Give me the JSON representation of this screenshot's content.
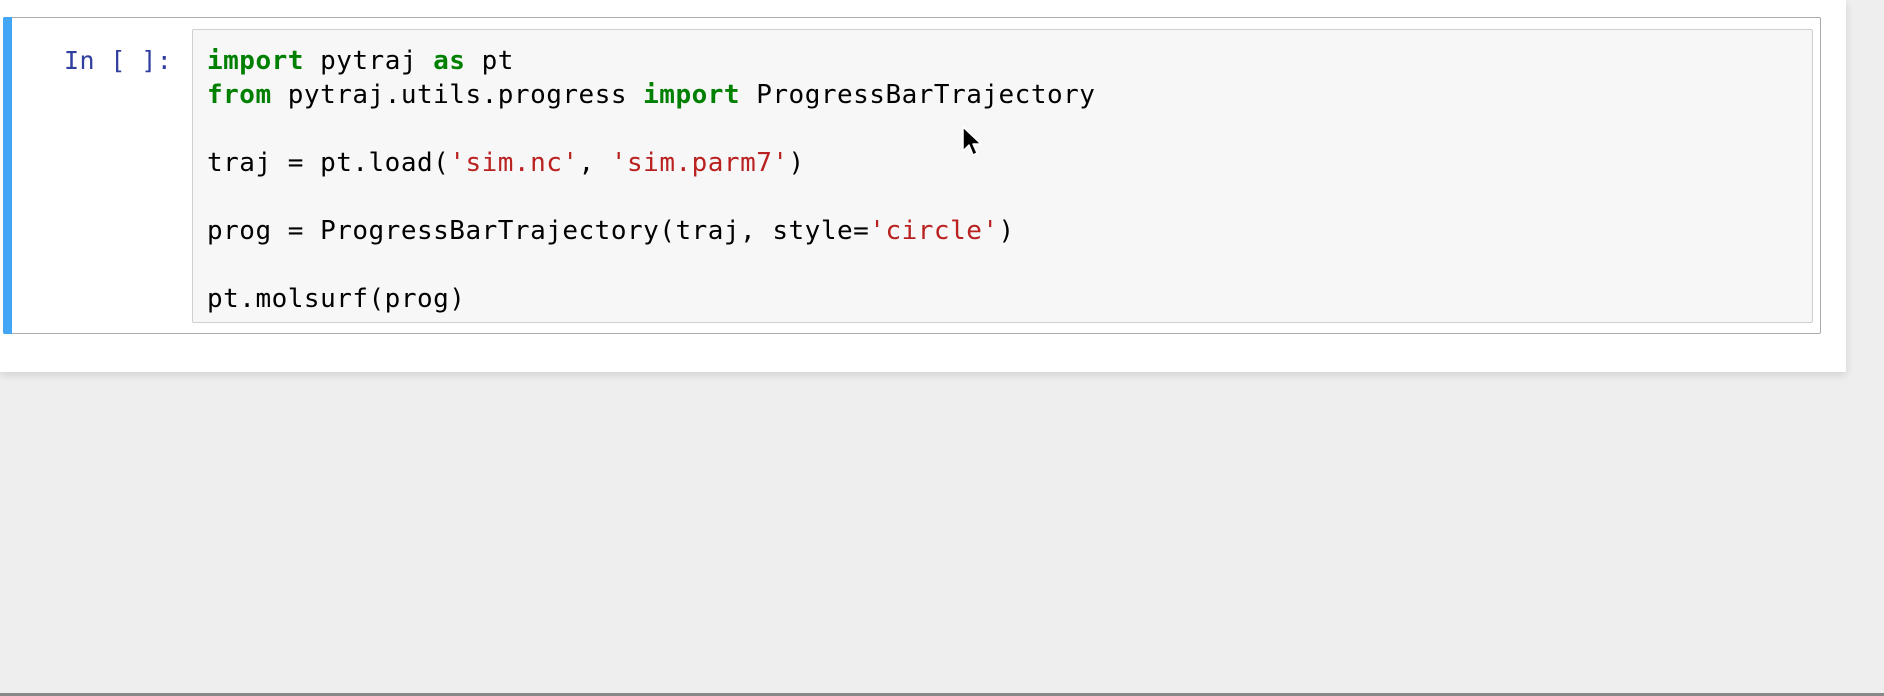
{
  "cell": {
    "prompt": "In [ ]:",
    "lines": [
      [
        {
          "t": "import",
          "k": "kw"
        },
        {
          "t": " pytraj ",
          "k": "plain"
        },
        {
          "t": "as",
          "k": "kw"
        },
        {
          "t": " pt",
          "k": "plain"
        }
      ],
      [
        {
          "t": "from",
          "k": "kw"
        },
        {
          "t": " pytraj.utils.progress ",
          "k": "plain"
        },
        {
          "t": "import",
          "k": "kw"
        },
        {
          "t": " ProgressBarTrajectory",
          "k": "plain"
        }
      ],
      [],
      [
        {
          "t": "traj = pt.load(",
          "k": "plain"
        },
        {
          "t": "'sim.nc'",
          "k": "str"
        },
        {
          "t": ", ",
          "k": "plain"
        },
        {
          "t": "'sim.parm7'",
          "k": "str"
        },
        {
          "t": ")",
          "k": "plain"
        }
      ],
      [],
      [
        {
          "t": "prog = ProgressBarTrajectory(traj, style=",
          "k": "plain"
        },
        {
          "t": "'circle'",
          "k": "str"
        },
        {
          "t": ")",
          "k": "plain"
        }
      ],
      [],
      [
        {
          "t": "pt.molsurf(prog)",
          "k": "plain"
        }
      ]
    ]
  },
  "icons": {
    "cursor": "mouse-pointer-icon"
  },
  "colors": {
    "cell_selected_bar": "#42a5f5",
    "prompt": "#303f9f",
    "keyword": "#008000",
    "string": "#ba2121",
    "editor_bg": "#f7f7f7",
    "page_bg": "#eeeeee"
  }
}
